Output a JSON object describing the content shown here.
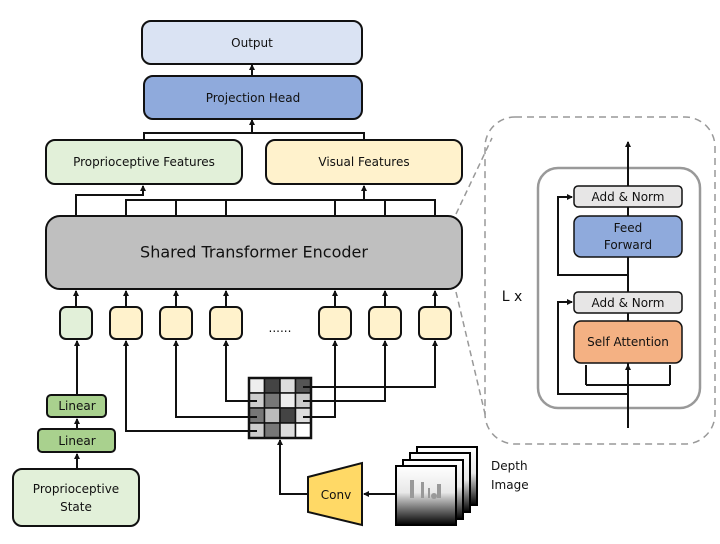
{
  "labels": {
    "output": "Output",
    "projection_head": "Projection Head",
    "proprioceptive_features": "Proprioceptive Features",
    "visual_features": "Visual Features",
    "encoder": "Shared Transformer Encoder",
    "ellipsis": "......",
    "linear_1": "Linear",
    "linear_2": "Linear",
    "proprioceptive_state_line1": "Proprioceptive",
    "proprioceptive_state_line2": "State",
    "conv": "Conv",
    "depth_image_line1": "Depth",
    "depth_image_line2": "Image",
    "layer_repeat": "L x",
    "add_norm_top": "Add & Norm",
    "feed_forward_line1": "Feed",
    "feed_forward_line2": "Forward",
    "add_norm_bottom": "Add & Norm",
    "self_attention": "Self Attention"
  },
  "colors": {
    "output": "#dae3f3",
    "projection_head": "#8faadc",
    "proprioceptive": "#e2f0d9",
    "linear": "#a9d18e",
    "visual": "#fff2cc",
    "encoder": "#bfbfbf",
    "conv": "#ffd966",
    "add_norm": "#e7e6e6",
    "feed_forward": "#8faadc",
    "self_attention": "#f4b183"
  }
}
